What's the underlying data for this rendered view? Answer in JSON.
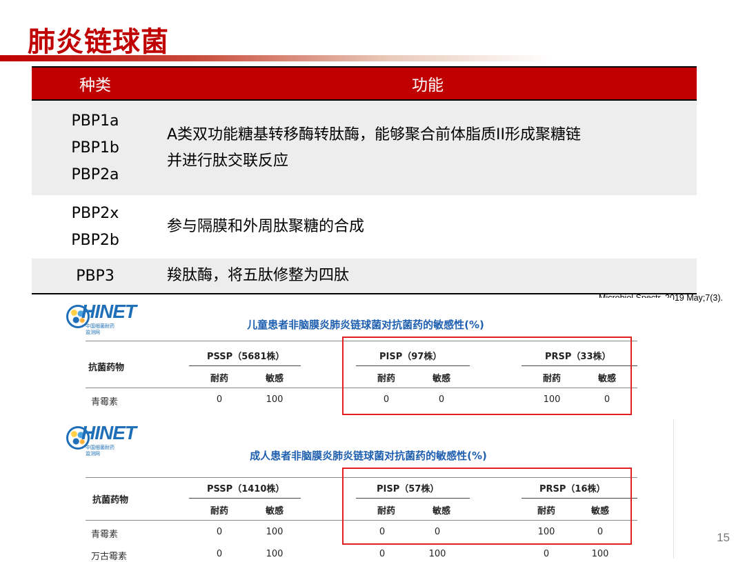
{
  "slide": {
    "title": "肺炎链球菌",
    "citation": "Microbiol Spectr. 2019 May;7(3).",
    "page_number": "15"
  },
  "table": {
    "headers": [
      "种类",
      "功能"
    ],
    "rows": [
      {
        "types": [
          "PBP1a",
          "PBP1b",
          "PBP2a"
        ],
        "function": [
          "A类双功能糖基转移酶转肽酶，能够聚合前体脂质II形成聚糖链",
          "并进行肽交联反应"
        ]
      },
      {
        "types": [
          "PBP2x",
          "PBP2b"
        ],
        "function": [
          "参与隔膜和外周肽聚糖的合成"
        ]
      },
      {
        "types": [
          "PBP3"
        ],
        "function": [
          "羧肽酶，将五肽修整为四肽"
        ]
      }
    ]
  },
  "panels": [
    {
      "logo": {
        "text": "HINET",
        "sub1": "中国细菌耐药",
        "sub2": "监测网"
      },
      "title": "儿童患者非脑膜炎肺炎链球菌对抗菌药的敏感性(%)",
      "drug_header": "抗菌药物",
      "groups": [
        "PSSP（5681株）",
        "PISP（97株）",
        "PRSP（33株）"
      ],
      "sub_headers": [
        "耐药",
        "敏感"
      ],
      "rows": [
        {
          "drug": "青霉素",
          "values": [
            "0",
            "100",
            "0",
            "0",
            "100",
            "0"
          ]
        }
      ]
    },
    {
      "logo": {
        "text": "HINET",
        "sub1": "中国细菌耐药",
        "sub2": "监测网"
      },
      "title": "成人患者非脑膜炎肺炎链球菌对抗菌药的敏感性(%)",
      "drug_header": "抗菌药物",
      "groups": [
        "PSSP（1410株）",
        "PISP（57株）",
        "PRSP（16株）"
      ],
      "sub_headers": [
        "耐药",
        "敏感"
      ],
      "rows": [
        {
          "drug": "青霉素",
          "values": [
            "0",
            "100",
            "0",
            "0",
            "100",
            "0"
          ]
        },
        {
          "drug": "万古霉素",
          "values": [
            "0",
            "100",
            "0",
            "100",
            "0",
            "100"
          ]
        }
      ]
    }
  ]
}
